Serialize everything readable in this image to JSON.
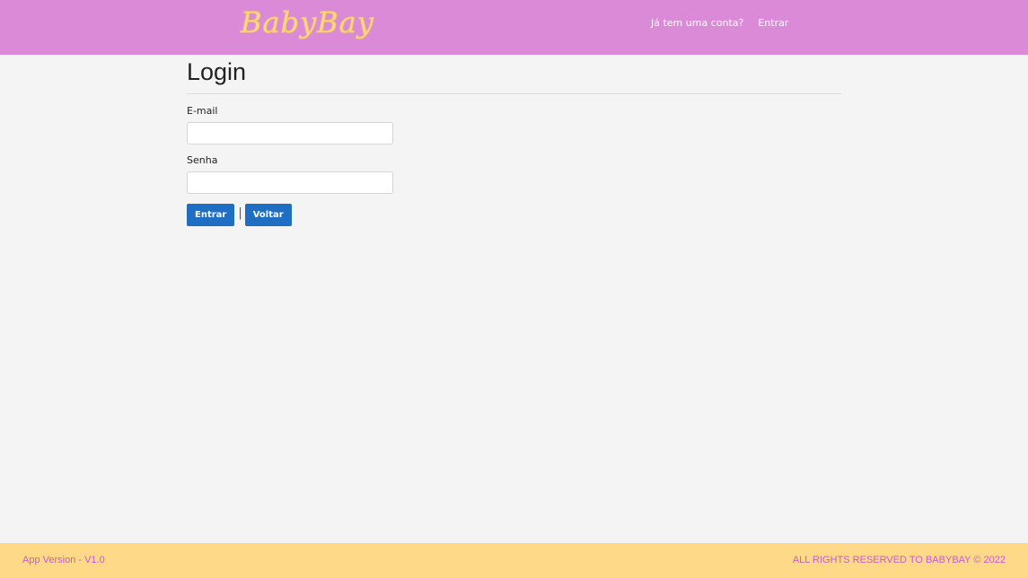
{
  "header": {
    "logo_text": "BabyBay",
    "account_prompt": "Já tem uma conta?",
    "login_link": "Entrar"
  },
  "main": {
    "title": "Login",
    "email_label": "E-mail",
    "email_value": "",
    "password_label": "Senha",
    "password_value": "",
    "separator": "|",
    "submit_label": "Entrar",
    "back_label": "Voltar"
  },
  "footer": {
    "version": "App Version - V1.0",
    "rights": "ALL RIGHTS RESERVED TO BABYBAY © 2022"
  },
  "colors": {
    "header_bg": "#da8ad6",
    "logo": "#fbd98a",
    "button": "#1f6ec1",
    "footer_bg": "#fed987",
    "footer_text": "#c85ad0"
  }
}
